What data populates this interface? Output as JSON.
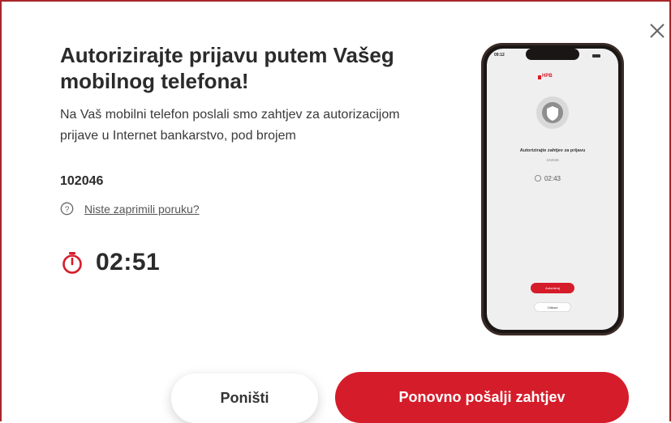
{
  "dialog": {
    "title": "Autorizirajte prijavu putem Vašeg mobilnog telefona!",
    "description": "Na Vaš mobilni telefon poslali smo zahtjev za autorizacijom prijave u Internet bankarstvo, pod brojem",
    "request_code": "102046",
    "help_link": "Niste zaprimili poruku?",
    "countdown": "02:51",
    "cancel_label": "Poništi",
    "resend_label": "Ponovno pošalji zahtjev"
  },
  "phone_preview": {
    "status_time": "09:12",
    "brand": "HPB",
    "screen_title": "Autorizirajte zahtjev za prijavu",
    "screen_subtitle": "102046",
    "countdown": "02:43",
    "authorize_button": "Autoriziraj",
    "reject_button": "Odbaci"
  },
  "colors": {
    "accent": "#d51c2a",
    "frame_border": "#a8262b",
    "text": "#2b2b2b"
  }
}
